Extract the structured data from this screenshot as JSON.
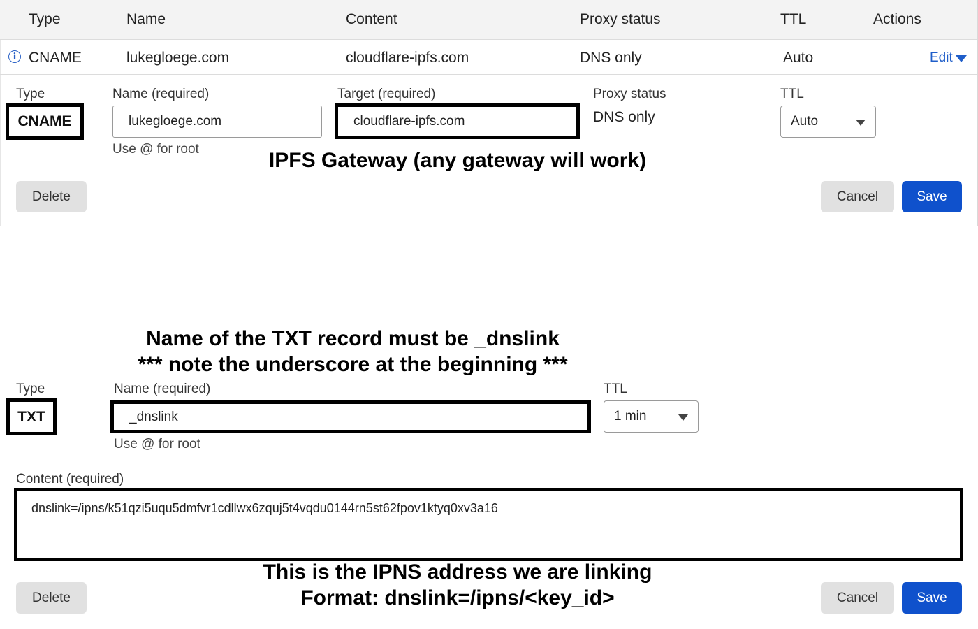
{
  "table": {
    "headers": [
      "Type",
      "Name",
      "Content",
      "Proxy status",
      "TTL",
      "Actions"
    ],
    "row": {
      "type": "CNAME",
      "name": "lukegloege.com",
      "content": "cloudflare-ipfs.com",
      "proxy_status": "DNS only",
      "ttl": "Auto",
      "action": "Edit"
    }
  },
  "cname_form": {
    "type_label": "Type",
    "type_value": "CNAME",
    "name_label": "Name (required)",
    "name_value": "lukegloege.com",
    "name_help": "Use @ for root",
    "target_label": "Target (required)",
    "target_value": "cloudflare-ipfs.com",
    "proxy_label": "Proxy status",
    "proxy_value": "DNS only",
    "ttl_label": "TTL",
    "ttl_value": "Auto",
    "delete_label": "Delete",
    "cancel_label": "Cancel",
    "save_label": "Save",
    "annotation": "IPFS Gateway (any gateway will work)"
  },
  "txt_form": {
    "annotation_line1": "Name of the TXT record must be _dnslink",
    "annotation_line2": "*** note the underscore at the beginning ***",
    "type_label": "Type",
    "type_value": "TXT",
    "name_label": "Name (required)",
    "name_value": "_dnslink",
    "name_help": "Use @ for root",
    "ttl_label": "TTL",
    "ttl_value": "1 min",
    "content_label": "Content (required)",
    "content_value": "dnslink=/ipns/k51qzi5uqu5dmfvr1cdllwx6zquj5t4vqdu0144rn5st62fpov1ktyq0xv3a16",
    "annotation_line3": "This is the IPNS address we are linking",
    "annotation_line4": "Format: dnslink=/ipns/<key_id>",
    "delete_label": "Delete",
    "cancel_label": "Cancel",
    "save_label": "Save"
  },
  "colors": {
    "accent": "#0f51cc",
    "link": "#1f5ec9",
    "highlight_border": "#000000",
    "header_bg": "#f3f3f3"
  },
  "icons": {
    "info": "info-icon",
    "edit_caret": "chevron-down-icon",
    "select_caret": "chevron-down-icon"
  }
}
